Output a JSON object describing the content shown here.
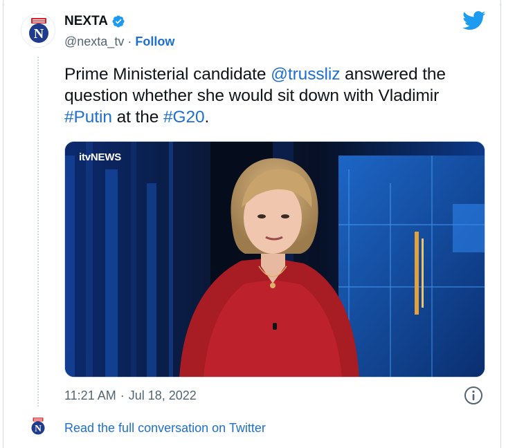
{
  "author": {
    "name": "NEXTA",
    "handle": "@nexta_tv",
    "separator": "·",
    "follow_label": "Follow"
  },
  "tweet": {
    "text_prefix": "Prime Ministerial candidate ",
    "mention": "@trussliz",
    "text_mid1": " answered the question whether she would sit down with Vladimir ",
    "hashtag1": "#Putin",
    "text_mid2": " at the ",
    "hashtag2": "#G20",
    "text_end": "."
  },
  "media": {
    "broadcaster_logo": "itvNEWS"
  },
  "meta": {
    "time": "11:21 AM",
    "separator": "·",
    "date": "Jul 18, 2022"
  },
  "footer": {
    "conversation_link": "Read the full conversation on Twitter"
  },
  "icons": {
    "verified": "verified-badge-icon",
    "brand": "twitter-bird-icon",
    "info": "info-icon"
  },
  "colors": {
    "link": "#1d6fd1",
    "verified": "#1d9bf0",
    "twitter": "#1d9bf0",
    "nexta_red": "#d8202a",
    "nexta_blue": "#1f3c8c"
  }
}
